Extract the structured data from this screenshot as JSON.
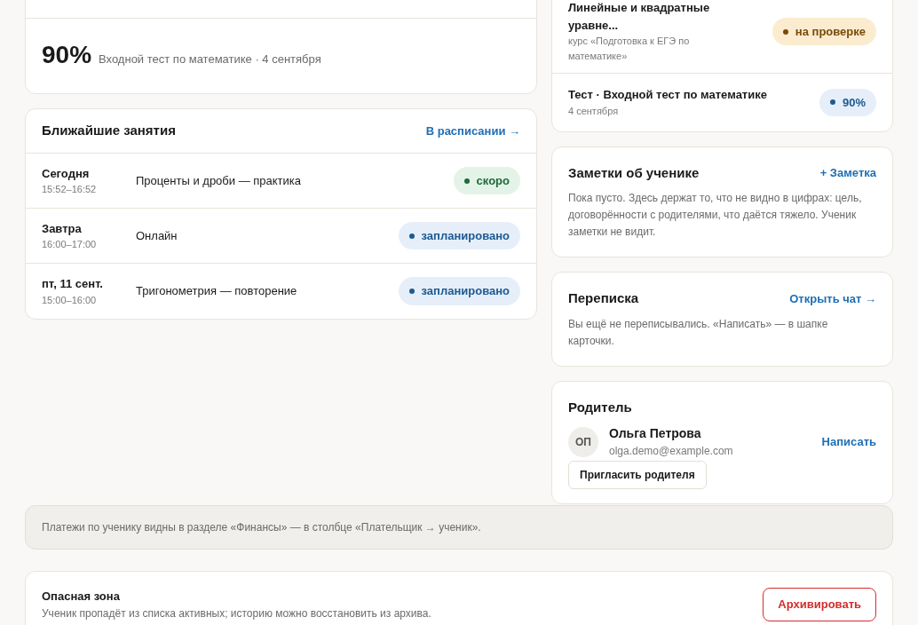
{
  "result_card": {
    "score": "90%",
    "caption": "Входной тест по математике · 4 сентября"
  },
  "lessons": {
    "title": "Ближайшие занятия",
    "link": "В расписании →",
    "items": [
      {
        "day": "Сегодня",
        "time": "15:52–16:52",
        "topic": "Проценты и дроби — практика",
        "status": "скоро",
        "kind": "soon"
      },
      {
        "day": "Завтра",
        "time": "16:00–17:00",
        "topic": "Онлайн",
        "status": "запланировано",
        "kind": "planned"
      },
      {
        "day": "пт, 11 сент.",
        "time": "15:00–16:00",
        "topic": "Тригонометрия — повторение",
        "status": "запланировано",
        "kind": "planned"
      }
    ]
  },
  "activity": [
    {
      "title": "Линейные и квадратные уравне...",
      "subtitle": "курс «Подготовка к ЕГЭ по математике»",
      "status": "на проверке",
      "kind": "review"
    },
    {
      "title": "Тест · Входной тест по математике",
      "subtitle": "4 сентября",
      "status": "90%",
      "kind": "score"
    }
  ],
  "notes": {
    "title": "Заметки об ученике",
    "link": "+ Заметка",
    "text": "Пока пусто. Здесь держат то, что не видно в цифрах: цель, договорённости с родителями, что даётся тяжело. Ученик заметки не видит."
  },
  "chat": {
    "title": "Переписка",
    "link": "Открыть чат →",
    "text": "Вы ещё не переписывались. «Написать» — в шапке карточки."
  },
  "parent": {
    "title": "Родитель",
    "initials": "ОП",
    "name": "Ольга Петрова",
    "email": "olga.demo@example.com",
    "write": "Написать",
    "invite": "Пригласить родителя"
  },
  "payments_note": "Платежи по ученику видны в разделе «Финансы» — в столбце «Плательщик → ученик».",
  "danger": {
    "title": "Опасная зона",
    "text": "Ученик пропадёт из списка активных; историю можно восстановить из архива.",
    "button": "Архивировать"
  }
}
